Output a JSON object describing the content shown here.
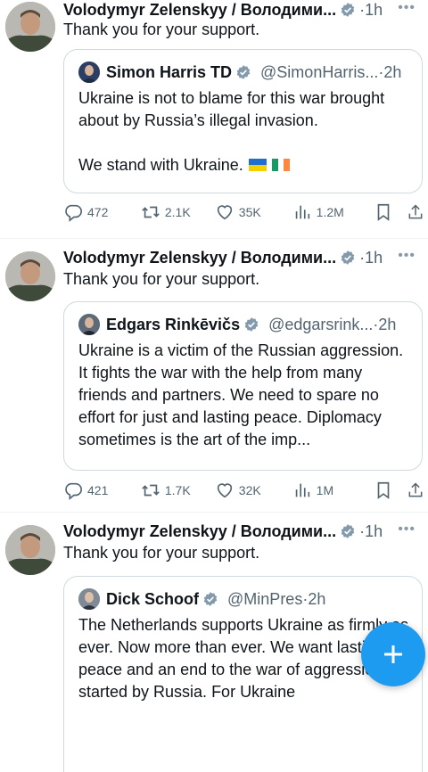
{
  "tweets": [
    {
      "author": "Volodymyr Zelenskyy / Володими...",
      "time": "1h",
      "more": "•••",
      "text": "Thank you for your support.",
      "quote": {
        "author": "Simon Harris TD",
        "handle": "@SimonHarris...",
        "time": "2h",
        "body": "Ukraine is not to blame for this war brought about by Russia’s illegal invasion.\n\nWe stand with Ukraine.",
        "flags": [
          "ukraine-flag",
          "ireland-flag"
        ]
      },
      "stats": {
        "replies": "472",
        "reposts": "2.1K",
        "likes": "35K",
        "views": "1.2M"
      }
    },
    {
      "author": "Volodymyr Zelenskyy / Володими...",
      "time": "1h",
      "more": "•••",
      "text": "Thank you for your support.",
      "quote": {
        "author": "Edgars Rinkēvičs",
        "handle": "@edgarsrink...",
        "time": "2h",
        "body": "Ukraine is a victim of the Russian aggression. It fights the war with the help from many friends and partners. We need to spare no effort for just and lasting peace. Diplomacy sometimes is the art of the imp..."
      },
      "stats": {
        "replies": "421",
        "reposts": "1.7K",
        "likes": "32K",
        "views": "1M"
      }
    },
    {
      "author": "Volodymyr Zelenskyy / Володими...",
      "time": "1h",
      "more": "•••",
      "text": "Thank you for your support.",
      "quote": {
        "author": "Dick Schoof",
        "handle": "@MinPres",
        "time": "2h",
        "body": "The Netherlands supports Ukraine as firmly as ever. Now more than ever. We want lasting peace and an end to the war of aggression started by Russia. For Ukraine"
      }
    }
  ],
  "colors": {
    "accent": "#1d9bf0",
    "text": "#0f1419",
    "muted": "#536471",
    "border": "#cfd9de"
  }
}
